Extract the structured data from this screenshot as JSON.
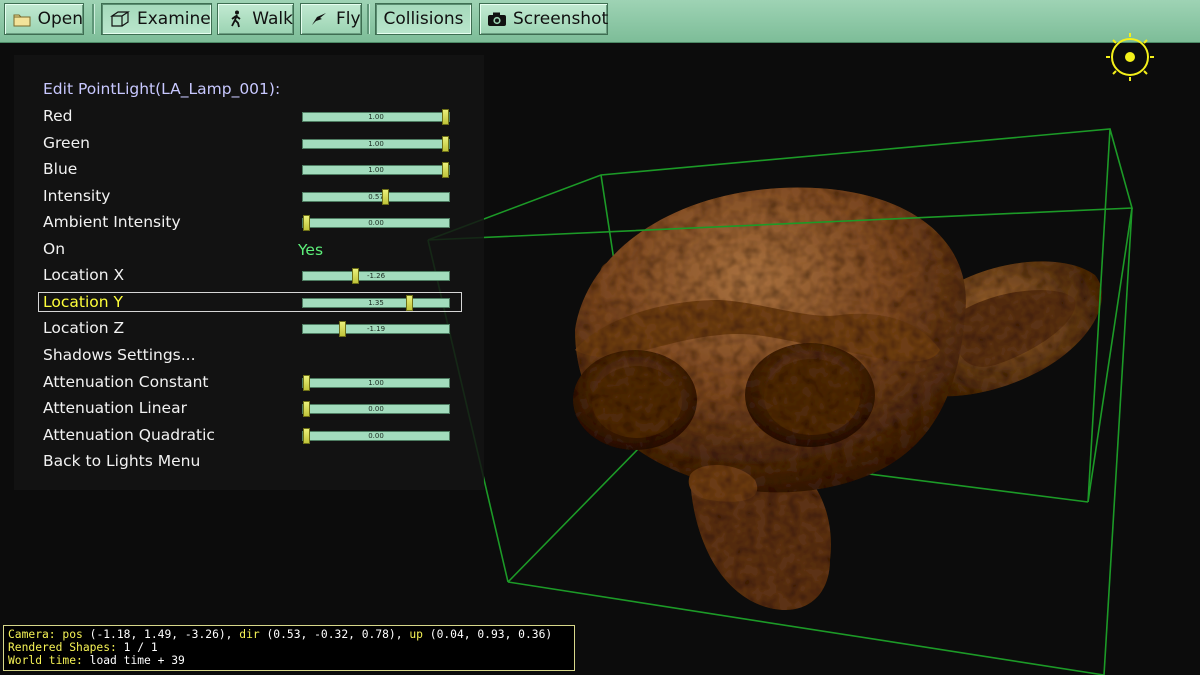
{
  "toolbar": {
    "open": "Open",
    "examine": "Examine",
    "walk": "Walk",
    "fly": "Fly",
    "collisions": "Collisions",
    "screenshot": "Screenshot"
  },
  "menu": {
    "title": "Edit PointLight(LA_Lamp_001):",
    "items": [
      {
        "label": "Red",
        "value": "1.00",
        "level": 1.0
      },
      {
        "label": "Green",
        "value": "1.00",
        "level": 1.0
      },
      {
        "label": "Blue",
        "value": "1.00",
        "level": 1.0
      },
      {
        "label": "Intensity",
        "value": "0.57",
        "level": 0.57
      },
      {
        "label": "Ambient Intensity",
        "value": "0.00",
        "level": 0.0
      },
      {
        "label": "On",
        "value": "Yes"
      },
      {
        "label": "Location X",
        "value": "-1.26",
        "level": 0.35
      },
      {
        "label": "Location Y",
        "value": "1.35",
        "level": 0.74
      },
      {
        "label": "Location Z",
        "value": "-1.19",
        "level": 0.26
      },
      {
        "label": "Shadows Settings..."
      },
      {
        "label": "Attenuation Constant",
        "value": "1.00",
        "level": 0.0
      },
      {
        "label": "Attenuation Linear",
        "value": "0.00",
        "level": 0.0
      },
      {
        "label": "Attenuation Quadratic",
        "value": "0.00",
        "level": 0.0
      },
      {
        "label": "Back to Lights Menu"
      }
    ],
    "selected": "Location Y"
  },
  "status": {
    "camera_label": "Camera:",
    "pos_label": "pos",
    "pos_value": "(-1.18, 1.49, -3.26),",
    "dir_label": "dir",
    "dir_value": "(0.53, -0.32, 0.78),",
    "up_label": "up",
    "up_value": "(0.04, 0.93, 0.36)",
    "rendered_label": "Rendered Shapes:",
    "rendered_value": "1 / 1",
    "world_label": "World time:",
    "world_value": "load time + 39"
  },
  "colors": {
    "toolbar_bg": "#8fcaa8",
    "menu_text": "#f2f2f2",
    "menu_selected": "#ffff3a",
    "menu_title": "#c8c8ff",
    "on_value": "#5df07a",
    "bbox_green": "#1fa82a",
    "sun_yellow": "#f4f01a",
    "model_brown": "#6b3d1c"
  }
}
